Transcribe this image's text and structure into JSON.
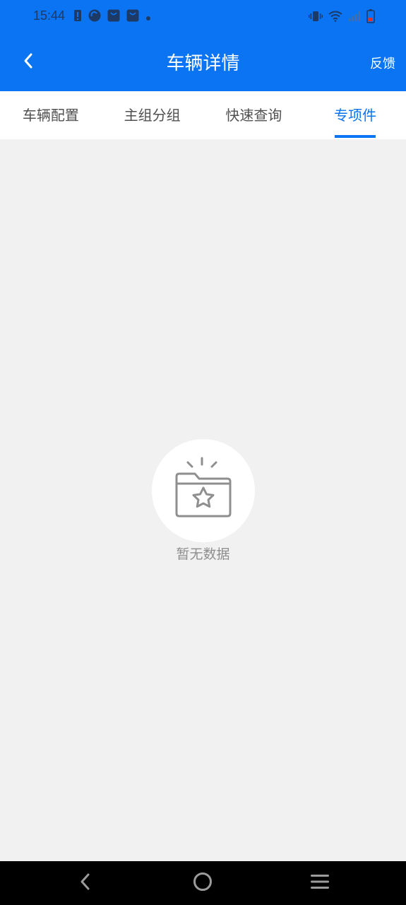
{
  "status_bar": {
    "time": "15:44",
    "left_icons": [
      "sim-alert-icon",
      "app-circle-icon",
      "bag-icon",
      "bag-icon",
      "dot-icon"
    ],
    "right_icons": [
      "vibrate-icon",
      "wifi-icon",
      "signal-icon",
      "battery-icon"
    ]
  },
  "app_bar": {
    "title": "车辆详情",
    "feedback_label": "反馈",
    "back_icon": "chevron-left-icon"
  },
  "tabs": [
    {
      "label": "车辆配置",
      "active": false
    },
    {
      "label": "主组分组",
      "active": false
    },
    {
      "label": "快速查询",
      "active": false
    },
    {
      "label": "专项件",
      "active": true
    }
  ],
  "empty_state": {
    "icon": "folder-star-icon",
    "text": "暂无数据"
  },
  "navigation_bar": {
    "buttons": [
      "back-nav-icon",
      "home-nav-icon",
      "menu-nav-icon"
    ]
  },
  "colors": {
    "primary": "#0a74f3",
    "background": "#f1f1f2",
    "tab_inactive": "#505050",
    "empty_text": "#8e8e8e"
  }
}
